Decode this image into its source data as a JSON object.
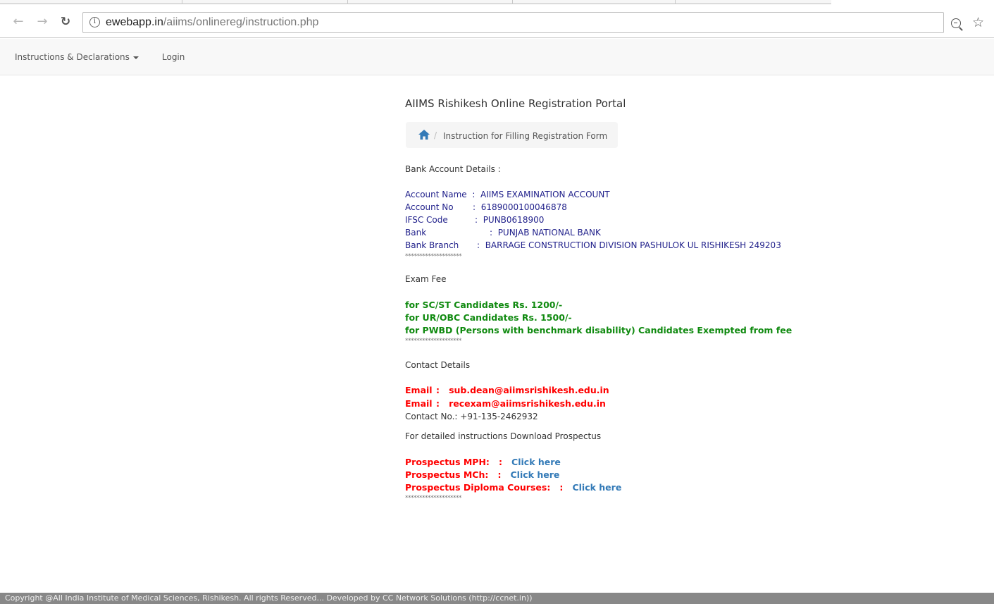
{
  "browser": {
    "url_host": "ewebapp.in",
    "url_path": "/aiims/onlinereg/instruction.php"
  },
  "nav": {
    "menu_label": "Instructions & Declarations",
    "login_label": "Login"
  },
  "page": {
    "title": "AIIMS Rishikesh Online Registration Portal",
    "breadcrumb_sep": "/",
    "breadcrumb_current": "Instruction for Filling Registration Form"
  },
  "bank": {
    "heading": "Bank Account Details :",
    "rows": [
      {
        "label": "Account Name",
        "sep": ":",
        "value": "AIIMS EXAMINATION ACCOUNT"
      },
      {
        "label": "Account No",
        "sep": ":",
        "value": "6189000100046878"
      },
      {
        "label": "IFSC Code",
        "sep": ":",
        "value": "PUNB0618900"
      },
      {
        "label": "Bank",
        "sep": ":",
        "value": "PUNJAB NATIONAL BANK"
      },
      {
        "label": "Bank Branch",
        "sep": ":",
        "value": "BARRAGE CONSTRUCTION DIVISION PASHULOK UL RISHIKESH 249203"
      }
    ],
    "stars": "********************"
  },
  "fee": {
    "heading": "Exam Fee",
    "lines": [
      "for SC/ST Candidates Rs. 1200/-",
      "for UR/OBC Candidates Rs. 1500/-",
      "for PWBD (Persons with benchmark disability) Candidates Exempted from fee"
    ],
    "stars": "********************"
  },
  "contact": {
    "heading": "Contact Details",
    "emails": [
      {
        "label": "Email",
        "sep": ":",
        "value": "sub.dean@aiimsrishikesh.edu.in"
      },
      {
        "label": "Email",
        "sep": ":",
        "value": "recexam@aiimsrishikesh.edu.in"
      }
    ],
    "phone": "Contact No.: +91-135-2462932",
    "download_text": "For detailed instructions Download Prospectus"
  },
  "prospectus": {
    "items": [
      {
        "label": "Prospectus MPH:",
        "sep": ":",
        "link": "Click here"
      },
      {
        "label": "Prospectus MCh:",
        "sep": ":",
        "link": "Click here"
      },
      {
        "label": "Prospectus Diploma Courses:",
        "sep": ":",
        "link": "Click here"
      }
    ],
    "stars": "********************"
  },
  "footer": {
    "text": "Copyright @All India Institute of Medical Sciences, Rishikesh. All rights Reserved... Developed by CC Network Solutions (http://ccnet.in))"
  },
  "colors": {
    "bank_text": "#1f1f8a",
    "fee_text": "#108a10",
    "email_text": "#ff0000",
    "link_text": "#337ab7",
    "footer_bg": "#888888"
  },
  "icons": [
    "back-arrow-icon",
    "forward-arrow-icon",
    "reload-icon",
    "info-icon",
    "zoom-icon",
    "bookmark-star-icon",
    "home-icon",
    "caret-down-icon"
  ]
}
